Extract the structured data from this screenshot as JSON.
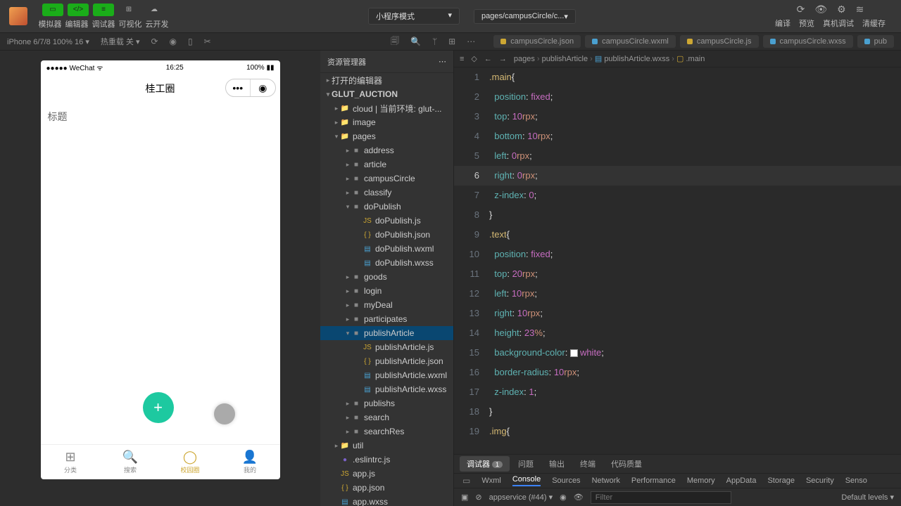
{
  "toolbar": {
    "sim": "模拟器",
    "editor": "编辑器",
    "debugger": "调试器",
    "visual": "可视化",
    "cloud": "云开发",
    "compile": "编译",
    "preview": "预览",
    "remote": "真机调试",
    "clear": "清缓存",
    "mode": "小程序模式",
    "page": "pages/campusCircle/c..."
  },
  "offbar": {
    "device": "iPhone 6/7/8 100% 16",
    "hot": "热重载 关"
  },
  "tabs": [
    "campusCircle.json",
    "campusCircle.wxml",
    "campusCircle.js",
    "campusCircle.wxss",
    "pub"
  ],
  "explorer": {
    "title": "资源管理器",
    "open": "打开的编辑器",
    "project": "GLUT_AUCTION",
    "items": [
      {
        "d": 0,
        "t": "cloud | 当前环境: glut-...",
        "i": "📁",
        "c": "#cda733",
        "ar": "▸"
      },
      {
        "d": 0,
        "t": "image",
        "i": "📁",
        "c": "#cf4a4a",
        "ar": "▸"
      },
      {
        "d": 0,
        "t": "pages",
        "i": "📁",
        "c": "#cf4a4a",
        "ar": "▾"
      },
      {
        "d": 1,
        "t": "address",
        "i": "■",
        "c": "#888",
        "ar": "▸"
      },
      {
        "d": 1,
        "t": "article",
        "i": "■",
        "c": "#888",
        "ar": "▸"
      },
      {
        "d": 1,
        "t": "campusCircle",
        "i": "■",
        "c": "#888",
        "ar": "▸"
      },
      {
        "d": 1,
        "t": "classify",
        "i": "■",
        "c": "#888",
        "ar": "▸"
      },
      {
        "d": 1,
        "t": "doPublish",
        "i": "■",
        "c": "#888",
        "ar": "▾"
      },
      {
        "d": 2,
        "t": "doPublish.js",
        "i": "JS",
        "c": "#cda733"
      },
      {
        "d": 2,
        "t": "doPublish.json",
        "i": "{ }",
        "c": "#cda733"
      },
      {
        "d": 2,
        "t": "doPublish.wxml",
        "i": "▤",
        "c": "#4aa0d0"
      },
      {
        "d": 2,
        "t": "doPublish.wxss",
        "i": "▤",
        "c": "#4aa0d0"
      },
      {
        "d": 1,
        "t": "goods",
        "i": "■",
        "c": "#888",
        "ar": "▸"
      },
      {
        "d": 1,
        "t": "login",
        "i": "■",
        "c": "#888",
        "ar": "▸"
      },
      {
        "d": 1,
        "t": "myDeal",
        "i": "■",
        "c": "#888",
        "ar": "▸"
      },
      {
        "d": 1,
        "t": "participates",
        "i": "■",
        "c": "#888",
        "ar": "▸"
      },
      {
        "d": 1,
        "t": "publishArticle",
        "i": "■",
        "c": "#888",
        "ar": "▾",
        "sel": true
      },
      {
        "d": 2,
        "t": "publishArticle.js",
        "i": "JS",
        "c": "#cda733"
      },
      {
        "d": 2,
        "t": "publishArticle.json",
        "i": "{ }",
        "c": "#cda733"
      },
      {
        "d": 2,
        "t": "publishArticle.wxml",
        "i": "▤",
        "c": "#4aa0d0"
      },
      {
        "d": 2,
        "t": "publishArticle.wxss",
        "i": "▤",
        "c": "#4aa0d0"
      },
      {
        "d": 1,
        "t": "publishs",
        "i": "■",
        "c": "#888",
        "ar": "▸"
      },
      {
        "d": 1,
        "t": "search",
        "i": "■",
        "c": "#888",
        "ar": "▸"
      },
      {
        "d": 1,
        "t": "searchRes",
        "i": "■",
        "c": "#888",
        "ar": "▸"
      },
      {
        "d": 0,
        "t": "util",
        "i": "📁",
        "c": "#5fb34a",
        "ar": "▸"
      },
      {
        "d": 0,
        "t": ".eslintrc.js",
        "i": "●",
        "c": "#7b61c9"
      },
      {
        "d": 0,
        "t": "app.js",
        "i": "JS",
        "c": "#cda733"
      },
      {
        "d": 0,
        "t": "app.json",
        "i": "{ }",
        "c": "#cda733"
      },
      {
        "d": 0,
        "t": "app.wxss",
        "i": "▤",
        "c": "#4aa0d0"
      }
    ]
  },
  "breadcrumb": [
    "pages",
    "publishArticle",
    "publishArticle.wxss",
    ".main"
  ],
  "code": [
    {
      "n": 1,
      "sel": ".main",
      "br": "{"
    },
    {
      "n": 2,
      "p": "position",
      "v": "fixed"
    },
    {
      "n": 3,
      "p": "top",
      "v": "10",
      "u": "rpx"
    },
    {
      "n": 4,
      "p": "bottom",
      "v": "10",
      "u": "rpx"
    },
    {
      "n": 5,
      "p": "left",
      "v": "0",
      "u": "rpx"
    },
    {
      "n": 6,
      "p": "right",
      "v": "0",
      "u": "rpx",
      "hl": true
    },
    {
      "n": 7,
      "p": "z-index",
      "v": "0"
    },
    {
      "n": 8,
      "br": "}"
    },
    {
      "n": 9,
      "sel": ".text",
      "br": "{"
    },
    {
      "n": 10,
      "p": "position",
      "v": "fixed"
    },
    {
      "n": 11,
      "p": "top",
      "v": "20",
      "u": "rpx"
    },
    {
      "n": 12,
      "p": "left",
      "v": "10",
      "u": "rpx"
    },
    {
      "n": 13,
      "p": "right",
      "v": "10",
      "u": "rpx"
    },
    {
      "n": 14,
      "p": "height",
      "v": "23",
      "u": "%"
    },
    {
      "n": 15,
      "p": "background-color",
      "v": "white",
      "sw": true
    },
    {
      "n": 16,
      "p": "border-radius",
      "v": "10",
      "u": "rpx"
    },
    {
      "n": 17,
      "p": "z-index",
      "v": "1"
    },
    {
      "n": 18,
      "br": "}"
    },
    {
      "n": 19,
      "sel": ".img",
      "br": "{"
    }
  ],
  "phone": {
    "carrier": "WeChat",
    "time": "16:25",
    "battery": "100%",
    "title": "桂工圈",
    "placeholder": "标题",
    "tabs": [
      "分类",
      "搜索",
      "校园圈",
      "我的"
    ]
  },
  "devtools": {
    "local": [
      "调试器",
      "问题",
      "输出",
      "终端",
      "代码质量"
    ],
    "cdp": [
      "Wxml",
      "Console",
      "Sources",
      "Network",
      "Performance",
      "Memory",
      "AppData",
      "Storage",
      "Security",
      "Senso"
    ],
    "ctx": "appservice (#44)",
    "filter": "Filter",
    "levels": "Default levels"
  }
}
